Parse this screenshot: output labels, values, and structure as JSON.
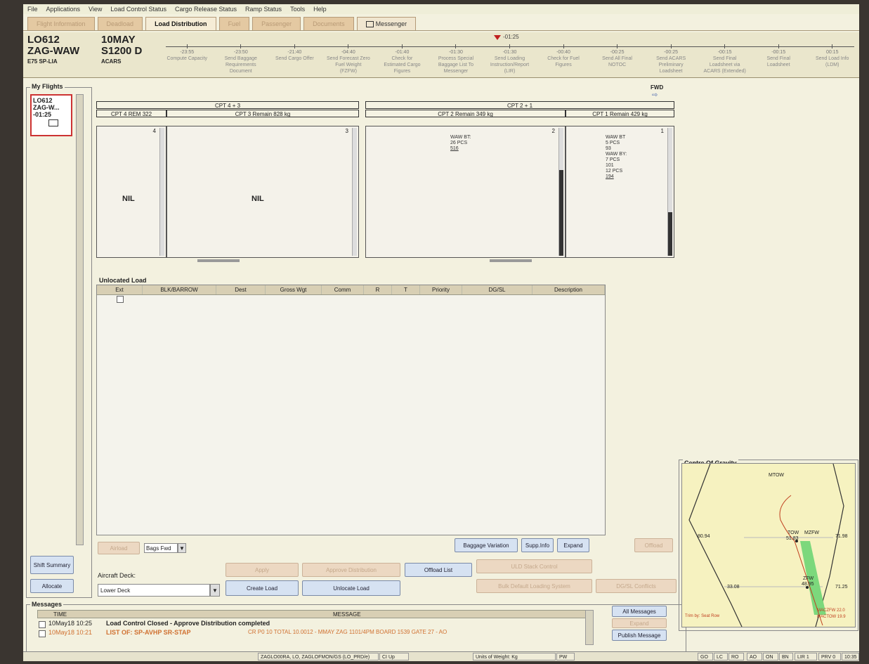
{
  "menu": [
    "File",
    "Applications",
    "View",
    "Load Control Status",
    "Cargo Release Status",
    "Ramp Status",
    "Tools",
    "Help"
  ],
  "tabs": [
    "Flight Information",
    "Deadload",
    "Load Distribution",
    "Fuel",
    "Passenger",
    "Documents",
    "Messenger"
  ],
  "flight": {
    "number": "LO612",
    "route": "ZAG-WAW",
    "aircraft": "E75 SP-LIA",
    "date": "10MAY",
    "std": "S1200 D",
    "mode": "ACARS"
  },
  "timeline": {
    "current": "-01:25",
    "milestones": [
      {
        "time": "-23:55",
        "label": "Compute Capacity"
      },
      {
        "time": "-23:50",
        "label": "Send Baggage Requirements Document"
      },
      {
        "time": "-21:40",
        "label": "Send Cargo Offer"
      },
      {
        "time": "-04:40",
        "label": "Send Forecast Zero Fuel Weight (FZFW)"
      },
      {
        "time": "-01:40",
        "label": "Check for Estimated Cargo Figures"
      },
      {
        "time": "-01:30",
        "label": "Process Special Baggage List To Messenger"
      },
      {
        "time": "-01:30",
        "label": "Send Loading Instruction/Report (LIR)"
      },
      {
        "time": "-00:40",
        "label": "Check for Fuel Figures"
      },
      {
        "time": "-00:25",
        "label": "Send All Final NOTOC"
      },
      {
        "time": "-00:25",
        "label": "Send ACARS Preliminary Loadsheet"
      },
      {
        "time": "-00:15",
        "label": "Send Final Loadsheet via ACARS (Extended)"
      },
      {
        "time": "-00:15",
        "label": "Send Final Loadsheet"
      },
      {
        "time": "00:15",
        "label": "Send Load Info (LDM)"
      }
    ]
  },
  "my_flights": {
    "title": "My Flights",
    "card": {
      "number": "LO612",
      "route": "ZAG-W...",
      "time": "-01:25"
    }
  },
  "left_buttons": {
    "shift_summary": "Shift Summary",
    "allocate": "Allocate"
  },
  "distribution": {
    "fwd": "FWD",
    "group_aft": "CPT 4 + 3",
    "group_fwd": "CPT 2 + 1",
    "cpt4": "CPT 4 REM 322",
    "cpt3": "CPT 3 Remain 828 kg",
    "cpt2": "CPT 2 Remain 349 kg",
    "cpt1": "CPT 1 Remain 429 kg",
    "hold4": {
      "num": "4",
      "text": "NIL"
    },
    "hold3": {
      "num": "3",
      "text": "NIL"
    },
    "hold2": {
      "num": "2",
      "l1": "WAW BT:",
      "l2": "26 PCS",
      "l3": "516"
    },
    "hold1": {
      "num": "1",
      "l1": "WAW BT",
      "l2": "5 PCS",
      "l3": "93",
      "l4": "WAW BY:",
      "l5": "7 PCS",
      "l6": "101",
      "l7": "12 PCS",
      "l8": "194"
    }
  },
  "unlocated": {
    "title": "Unlocated Load",
    "columns": [
      "Ext",
      "BLK/BARROW",
      "Dest",
      "Gross Wgt",
      "Comm",
      "R",
      "T",
      "Priority",
      "DG/SL",
      "Description"
    ]
  },
  "controls": {
    "airload": "Airload",
    "bags_select": "Bags Fwd",
    "baggage_variation": "Baggage Variation",
    "supp_info": "Supp.Info",
    "expand": "Expand",
    "aircraft_deck_label": "Aircraft Deck:",
    "deck_select": "Lower Deck",
    "apply": "Apply",
    "approve": "Approve Distribution",
    "create_load": "Create Load",
    "unlocate_load": "Unlocate Load",
    "offload_list": "Offload List",
    "uld_stack": "ULD Stack Control",
    "bulk_loading": "Bulk Default Loading System",
    "dg_conflicts": "DG/SL Conflicts",
    "offload": "Offload"
  },
  "messages": {
    "title": "Messages",
    "col_time": "TIME",
    "col_message": "MESSAGE",
    "rows": [
      {
        "time": "10May18 10:25",
        "text": "Load Control Closed - Approve Distribution completed",
        "extra": ""
      },
      {
        "time": "10May18 10:21",
        "text": "LIST OF: SP-AVHP  SR-STAP",
        "extra": "CR P0 10 TOTAL 10.0012 - MMAY ZAG 1101/4PM      BOARD 1539 GATE 27 - AO"
      }
    ],
    "all_messages": "All Messages",
    "expand": "Expand",
    "publish": "Publish Message"
  },
  "cog": {
    "title": "Centre Of Gravity",
    "mtow": "MTOW",
    "tow": "TOW",
    "tow_val": "51.83",
    "mzfw": "MZFW",
    "zfw": "ZFW",
    "zfw_val": "48.95",
    "left_top": "80.94",
    "left_bottom": "33.08",
    "right_top": "71.98",
    "right_bottom": "71.25",
    "trim": "Trim by: Seat Row",
    "mac_zfw": "MACZFW 22.0",
    "mac_tow": "MACTOW 19.9"
  },
  "status": [
    "ZAGLO00RA, LO, ZAGLOFMON/GS (LO_PRD/e)",
    "CI Up",
    "Units of Weight: Kg",
    "PW",
    "GO",
    "LC",
    "RO",
    "AO",
    "ON",
    "BN",
    "LIR 1",
    "PRV 0",
    "10:35"
  ]
}
